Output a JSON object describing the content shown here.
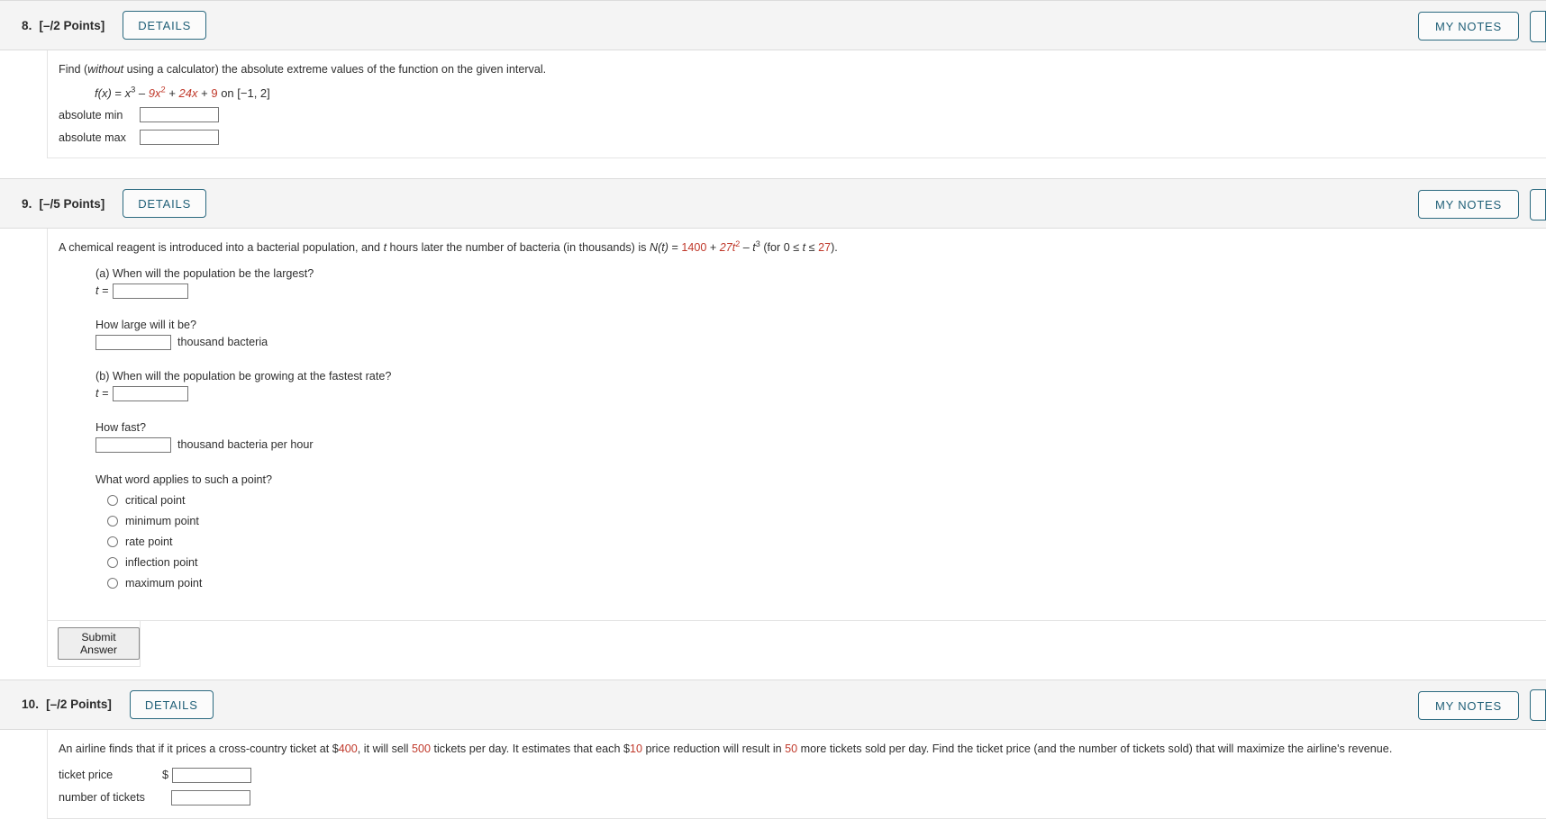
{
  "colors": {
    "accent": "#1f5f77",
    "accent_border": "#2c6a80",
    "red_value": "#c0392b",
    "header_bg": "#f4f4f4"
  },
  "questions": [
    {
      "number": "8.",
      "points": "[–/2 Points]",
      "details_label": "DETAILS",
      "notes_label": "MY NOTES",
      "prompt_parts": {
        "p1": "Find (",
        "p2": "without",
        "p3": " using a calculator) the absolute extreme values of the function on the given interval."
      },
      "formula": {
        "fx": "f(x)",
        "eq": " = ",
        "x": "x",
        "x_exp": "3",
        "minus": " – ",
        "c9": "9x",
        "c9_exp": "2",
        "plus1": " + ",
        "c24": "24x",
        "plus2": " + ",
        "c9b": "9",
        "on": " on [−1, 2]"
      },
      "answers": [
        {
          "label": "absolute min",
          "value": "",
          "placeholder": ""
        },
        {
          "label": "absolute max",
          "value": "",
          "placeholder": ""
        }
      ]
    },
    {
      "number": "9.",
      "points": "[–/5 Points]",
      "details_label": "DETAILS",
      "notes_label": "MY NOTES",
      "prompt": {
        "s1": "A chemical reagent is introduced into a bacterial population, and ",
        "t1": "t",
        "s2": " hours later the number of bacteria (in thousands) is ",
        "nt": "N(t)",
        "eq": " = ",
        "v1400": "1400",
        "plus": " + ",
        "v27t": "27t",
        "v27t_exp": "2",
        "minus": " – ",
        "t3": "t",
        "t3_exp": "3",
        "tail_open": " (for 0 ≤ ",
        "t2": "t",
        "tail_le": " ≤ ",
        "v27": "27",
        "tail_close": ")."
      },
      "parts": [
        {
          "label": "(a) When will the population be the largest?",
          "input_prefix": "t =",
          "value": ""
        },
        {
          "label": "How large will it be?",
          "unit": "thousand bacteria",
          "value": ""
        },
        {
          "label": "(b) When will the population be growing at the fastest rate?",
          "input_prefix": "t =",
          "value": ""
        },
        {
          "label": "How fast?",
          "unit": "thousand bacteria per hour",
          "value": ""
        }
      ],
      "radio_question": "What word applies to such a point?",
      "radio_options": [
        "critical point",
        "minimum point",
        "rate point",
        "inflection point",
        "maximum point"
      ],
      "submit_label": "Submit Answer"
    },
    {
      "number": "10.",
      "points": "[–/2 Points]",
      "details_label": "DETAILS",
      "notes_label": "MY NOTES",
      "prompt": {
        "s1": "An airline finds that if it prices a cross-country ticket at $",
        "v400": "400",
        "s2": ", it will sell ",
        "v500": "500",
        "s3": " tickets per day. It estimates that each $",
        "v10": "10",
        "s4": " price reduction will result in ",
        "v50": "50",
        "s5": " more tickets sold per day. Find the ticket price (and the number of tickets sold) that will maximize the airline's revenue."
      },
      "answers": [
        {
          "label": "ticket price",
          "prefix": "$",
          "value": ""
        },
        {
          "label": "number of tickets",
          "prefix": "",
          "value": ""
        }
      ]
    }
  ]
}
